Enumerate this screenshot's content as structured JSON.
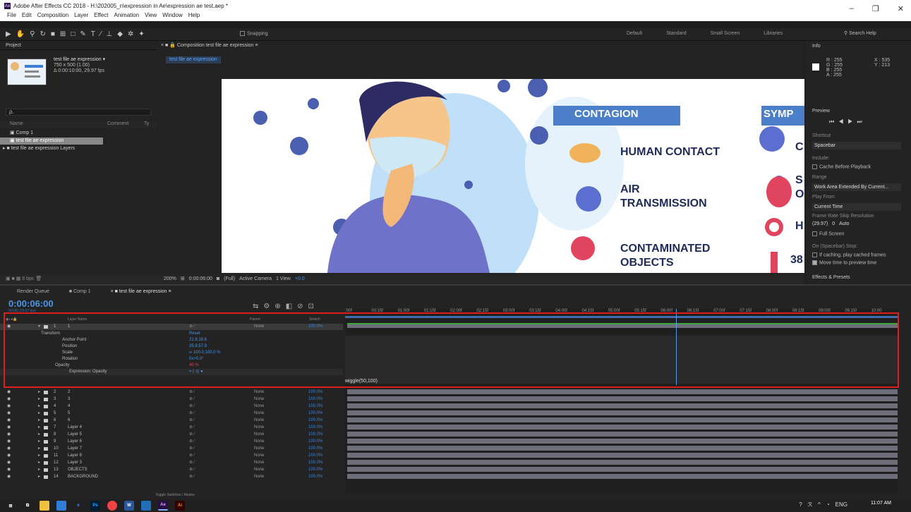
{
  "window": {
    "title": "Adobe After Effects CC 2018 - H:\\202005_n\\expression in Ae\\expression ae test.aep *",
    "app_badge": "Ae",
    "controls": [
      "–",
      "❐",
      "✕"
    ]
  },
  "menu": [
    "File",
    "Edit",
    "Composition",
    "Layer",
    "Effect",
    "Animation",
    "View",
    "Window",
    "Help"
  ],
  "toolbar": {
    "snapping": "Snapping",
    "workspaces": [
      "Default",
      "Standard",
      "Small Screen",
      "Libraries"
    ],
    "search_placeholder": "Search Help"
  },
  "project": {
    "title": "Project",
    "comp_name": "test file ae expression ▾",
    "comp_size": "750 x 500 (1.00)",
    "comp_duration": "Δ 0:00:10:00, 29.97 fps",
    "search": "ρ.",
    "col_name": "Name",
    "col_comment": "Comment",
    "col_type": "Ty",
    "items": [
      "Comp 1",
      "test file ae expression",
      "test file ae expression Layers"
    ],
    "bpc": "8 bpc"
  },
  "composition": {
    "tab": "Composition test file ae expression",
    "subtab": "test file ae expression",
    "zoom": "200%",
    "time": "0:00:06:00",
    "resolution": "(Full)",
    "camera": "Active Camera",
    "view": "1 View",
    "exposure": "+0.0"
  },
  "artwork": {
    "heading1": "CONTAGION",
    "heading2": "SYMP",
    "items": [
      "HUMAN CONTACT",
      "AIR",
      "TRANSMISSION",
      "CONTAMINATED",
      "OBJECTS"
    ],
    "side_letters": [
      "C",
      "S",
      "O",
      "H",
      "38"
    ]
  },
  "info": {
    "title": "Info",
    "r": "R : 255",
    "g": "G : 255",
    "b": "B : 255",
    "a": "A : 255",
    "x": "X : 535",
    "y": "Y : 213"
  },
  "preview": {
    "title": "Preview",
    "shortcut_label": "Shortcut",
    "shortcut": "Spacebar",
    "include": "Include:",
    "cache": "Cache Before Playback",
    "range_label": "Range",
    "range": "Work Area Extended By Current...",
    "playfrom_label": "Play From",
    "playfrom": "Current Time",
    "fr_label": "Frame Rate  Skip     Resolution",
    "fr": "(29.97)",
    "skip": "0",
    "res": "Auto",
    "fullscreen": "Full Screen",
    "stop_label": "On (Spacebar) Stop:",
    "stop1": "If caching, play cached frames",
    "stop2": "Move time to preview time",
    "effects": "Effects & Presets"
  },
  "timeline": {
    "tabs": [
      "Render Queue",
      "Comp 1",
      "test file ae expression"
    ],
    "timecode": "0:00:06:00",
    "fps_sub": "00180 (29.97 fps)",
    "headers": {
      "layer": "Layer Name",
      "parent": "Parent",
      "stretch": "Stretch"
    },
    "ruler": [
      ":00f",
      "00:15f",
      "01:00f",
      "01:15f",
      "02:00f",
      "02:15f",
      "03:00f",
      "03:15f",
      "04:00f",
      "04:15f",
      "05:00f",
      "05:15f",
      "06:00f",
      "06:15f",
      "07:00f",
      "07:15f",
      "08:00f",
      "08:15f",
      "09:00f",
      "09:15f",
      "10:00"
    ],
    "layer1": {
      "num": "1",
      "name": "1",
      "parent": "None",
      "stretch": "100.0%"
    },
    "props": [
      {
        "name": "Transform",
        "val": "Reset"
      },
      {
        "name": "Anchor Point",
        "val": "21.8,19.6"
      },
      {
        "name": "Position",
        "val": "35.9,57.9"
      },
      {
        "name": "Scale",
        "val": "∞ 100.0,100.0 %"
      },
      {
        "name": "Rotation",
        "val": "0x+0.0°"
      },
      {
        "name": "Opacity",
        "val": "40 %"
      },
      {
        "name": "Expression: Opacity",
        "val": "= ⌊ ◎ ●"
      }
    ],
    "expression": "wiggle(50,100)",
    "layers": [
      {
        "num": "2",
        "name": "2"
      },
      {
        "num": "3",
        "name": "3"
      },
      {
        "num": "4",
        "name": "4"
      },
      {
        "num": "5",
        "name": "5"
      },
      {
        "num": "6",
        "name": "6"
      },
      {
        "num": "7",
        "name": "Layer 4"
      },
      {
        "num": "8",
        "name": "Layer 5"
      },
      {
        "num": "9",
        "name": "Layer 6"
      },
      {
        "num": "10",
        "name": "Layer 7"
      },
      {
        "num": "11",
        "name": "Layer 8"
      },
      {
        "num": "12",
        "name": "Layer 3"
      },
      {
        "num": "13",
        "name": "OBJECTS"
      },
      {
        "num": "14",
        "name": "BACKGROUND"
      }
    ],
    "parent_none": "None",
    "stretch": "100.0%",
    "toggle": "Toggle Switches / Modes"
  },
  "taskbar": {
    "time": "11:07 AM",
    "lang": "ENG"
  }
}
